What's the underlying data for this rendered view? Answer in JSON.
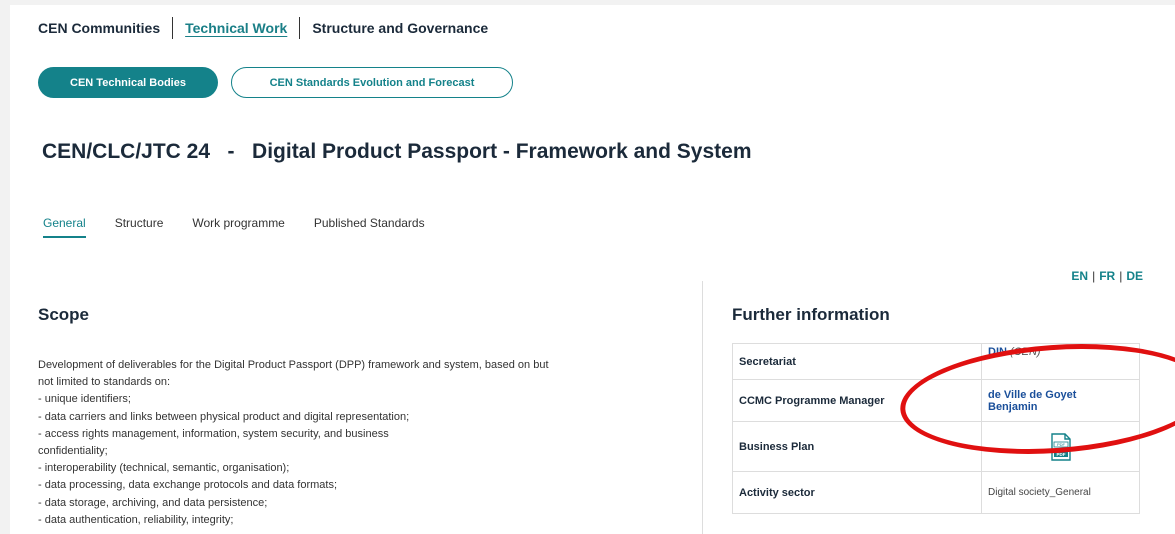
{
  "topnav": [
    "CEN Communities",
    "Technical Work",
    "Structure and Governance"
  ],
  "pills": {
    "primary": "CEN Technical Bodies",
    "secondary": "CEN Standards Evolution and Forecast"
  },
  "title": "CEN/CLC/JTC 24   -   Digital Product Passport - Framework and System",
  "tabs": [
    "General",
    "Structure",
    "Work programme",
    "Published Standards"
  ],
  "lang": [
    "EN",
    "FR",
    "DE"
  ],
  "scope": {
    "heading": "Scope",
    "lines": [
      "Development of deliverables for the Digital Product Passport (DPP) framework and system, based on but",
      "not limited to standards on:",
      "- unique identifiers;",
      "- data carriers and links between physical product and digital representation;",
      "- access rights management, information, system security, and business",
      "confidentiality;",
      "- interoperability (technical, semantic, organisation);",
      "- data processing, data exchange protocols and data formats;",
      "- data storage, archiving, and data persistence;",
      "- data authentication, reliability, integrity;"
    ]
  },
  "further": {
    "heading": "Further information",
    "secretariat_label": "Secretariat",
    "secretariat_value": "DIN",
    "secretariat_paren": "(CEN)",
    "ccmc_label": "CCMC Programme Manager",
    "ccmc_value_1": "de Ville de Goyet",
    "ccmc_value_2": "Benjamin",
    "plan_label": "Business Plan",
    "pdf_top": "PDF",
    "pdf_bottom": "PDF",
    "sector_label": "Activity sector",
    "sector_value": "Digital society_General"
  },
  "colors": {
    "accent": "#14828a",
    "link": "#1a4f9a",
    "annotation": "#e01010"
  }
}
